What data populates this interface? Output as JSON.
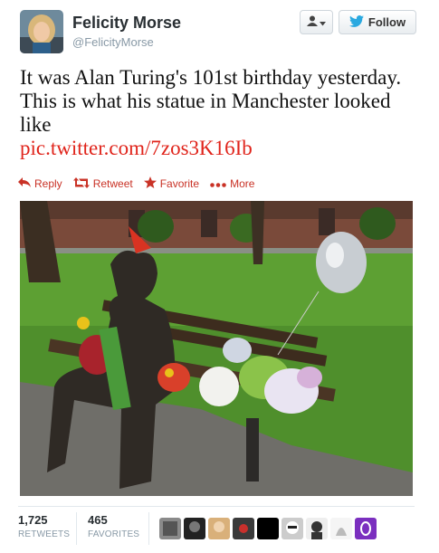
{
  "user": {
    "display_name": "Felicity Morse",
    "screen_name": "@FelicityMorse"
  },
  "header": {
    "follow_label": "Follow"
  },
  "tweet": {
    "text": "It was Alan Turing's 101st birthday yesterday. This is what his statue in Manchester looked like",
    "link": "pic.twitter.com/7zos3K16Ib"
  },
  "actions": [
    {
      "label": "Reply",
      "icon": "reply-icon"
    },
    {
      "label": "Retweet",
      "icon": "retweet-icon"
    },
    {
      "label": "Favorite",
      "icon": "star-icon"
    },
    {
      "label": "More",
      "icon": "more-dots-icon"
    }
  ],
  "stats": {
    "retweets_count": "1,725",
    "retweets_label": "RETWEETS",
    "favorites_count": "465",
    "favorites_label": "FAVORITES"
  },
  "colors": {
    "accent_red": "#c93226",
    "link_red": "#e0241b",
    "muted": "#8899a6"
  }
}
